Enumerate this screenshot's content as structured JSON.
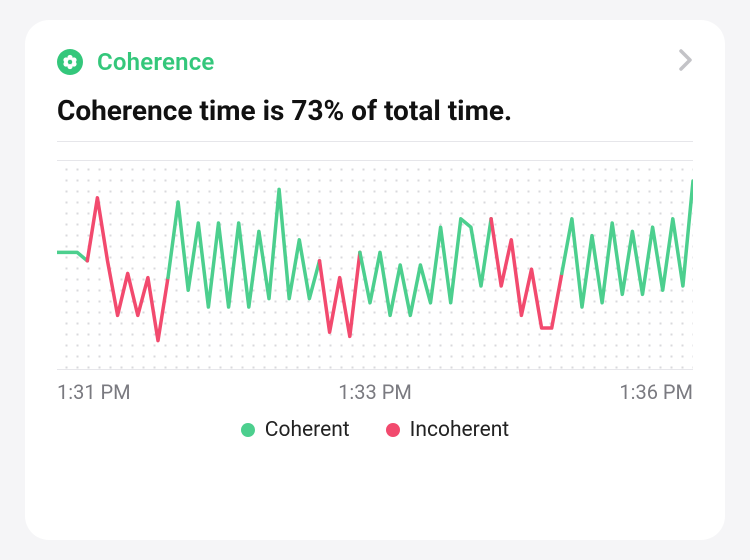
{
  "header": {
    "title": "Coherence",
    "icon_name": "coherence-flower-icon"
  },
  "summary": {
    "text": "Coherence time is 73% of total time."
  },
  "legend": {
    "coherent_label": "Coherent",
    "incoherent_label": "Incoherent"
  },
  "colors": {
    "coherent": "#4ccf8e",
    "incoherent": "#f24a6e",
    "accent": "#34c77b"
  },
  "x_ticks": [
    "1:31 PM",
    "1:33 PM",
    "1:36 PM"
  ],
  "chart_data": {
    "type": "line",
    "title": "Coherence",
    "xlabel": "",
    "ylabel": "",
    "ylim": [
      0,
      100
    ],
    "x_tick_labels": [
      "1:31 PM",
      "1:33 PM",
      "1:36 PM"
    ],
    "legend_position": "bottom",
    "series": [
      {
        "name": "Coherent",
        "color": "#4ccf8e"
      },
      {
        "name": "Incoherent",
        "color": "#f24a6e"
      }
    ],
    "segments": [
      {
        "state": "coherent",
        "values": [
          56,
          56,
          56,
          52
        ]
      },
      {
        "state": "incoherent",
        "values": [
          52,
          82,
          52,
          26,
          46,
          26,
          44,
          14,
          44
        ]
      },
      {
        "state": "coherent",
        "values": [
          44,
          80,
          38,
          70,
          30,
          70,
          30,
          70,
          30,
          66,
          34,
          86,
          34,
          62,
          34,
          52
        ]
      },
      {
        "state": "incoherent",
        "values": [
          52,
          18,
          44,
          16,
          56
        ]
      },
      {
        "state": "coherent",
        "values": [
          56,
          32,
          56,
          26,
          50,
          26,
          50,
          32,
          68,
          32,
          72,
          68,
          40,
          72
        ]
      },
      {
        "state": "incoherent",
        "values": [
          72,
          40,
          62,
          26,
          48,
          20,
          20,
          46
        ]
      },
      {
        "state": "coherent",
        "values": [
          46,
          72,
          30,
          64,
          32,
          70,
          36,
          66,
          36,
          68,
          38,
          72,
          40,
          90
        ]
      }
    ]
  }
}
